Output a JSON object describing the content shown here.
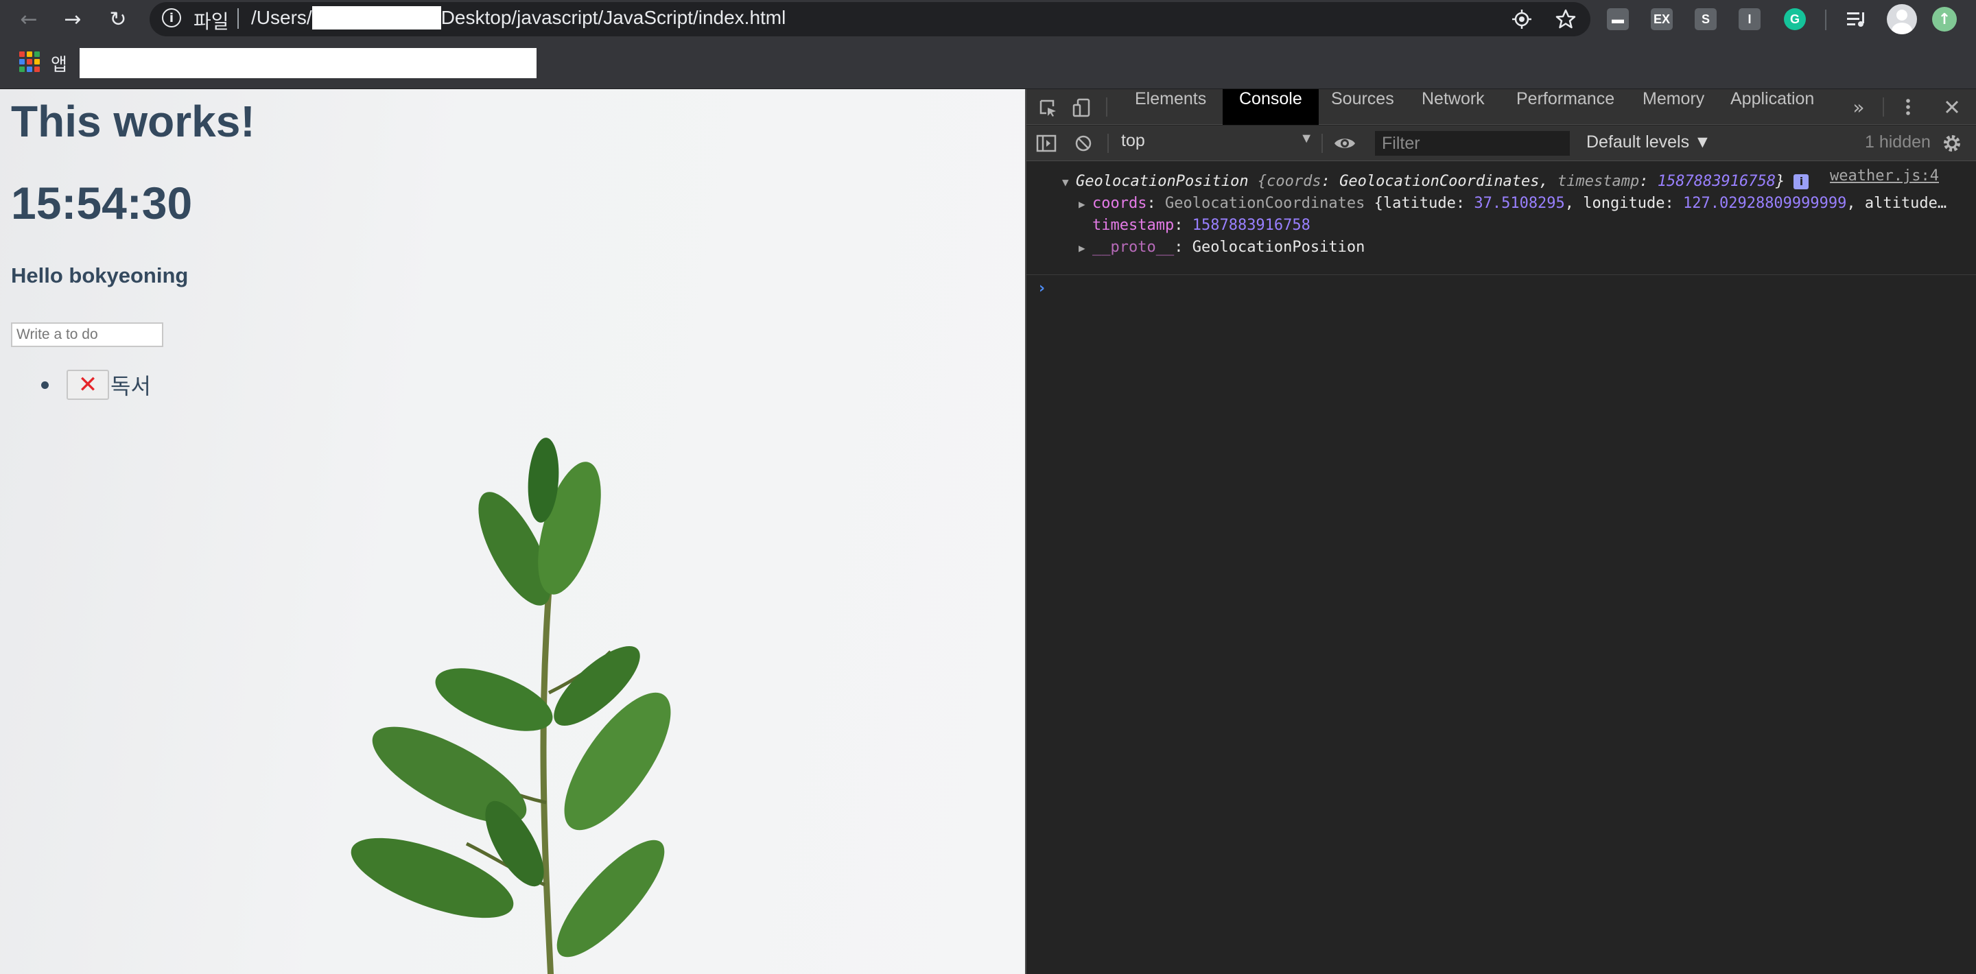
{
  "browser": {
    "nav": {
      "back_icon": "←",
      "forward_icon": "→",
      "reload_icon": "↻"
    },
    "omnibox": {
      "info_icon": "i",
      "scheme_label": "파일",
      "url_prefix": "/Users/",
      "url_suffix": "Desktop/javascript/JavaScript/index.html"
    },
    "extensions": [
      {
        "name": "extension-1-icon",
        "label": "▬",
        "color": "#5f6368"
      },
      {
        "name": "extension-ex-icon",
        "label": "EX",
        "color": "#5f6368"
      },
      {
        "name": "extension-s-icon",
        "label": "S",
        "color": "#5f6368"
      },
      {
        "name": "extension-i-icon",
        "label": "I",
        "color": "#5f6368"
      },
      {
        "name": "grammarly-icon",
        "label": "G",
        "color": "#15c39a"
      }
    ],
    "update_icon": "↑"
  },
  "bookmarks": {
    "apps_label": "앱"
  },
  "page": {
    "title": "This works!",
    "clock": "15:54:30",
    "greeting": "Hello bokyeoning",
    "todo_placeholder": "Write a to do",
    "todos": [
      {
        "delete_label": "✕",
        "text": "독서"
      }
    ]
  },
  "devtools": {
    "tabs": [
      "Elements",
      "Console",
      "Sources",
      "Network",
      "Performance",
      "Memory",
      "Application"
    ],
    "active_tab": "Console",
    "more_tabs": "»",
    "context": "top",
    "filter_placeholder": "Filter",
    "levels": "Default levels ▼",
    "hidden": "1 hidden",
    "console": {
      "source": "weather.js:4",
      "summary_type": "GeolocationPosition",
      "summary_open": " {",
      "summary_coords_key": "coords",
      "summary_coords_val": ": GeolocationCoordinates, ",
      "summary_ts_key": "timestamp",
      "summary_ts_sep": ": ",
      "summary_ts_val": "1587883916758",
      "summary_close": "}",
      "info_badge": "i",
      "coords_key": "coords",
      "coords_sep": ": ",
      "coords_type": "GeolocationCoordinates",
      "coords_lat_prefix": " {latitude: ",
      "coords_lat": "37.5108295",
      "coords_lng_prefix": ", longitude: ",
      "coords_lng": "127.02928809999999",
      "coords_tail": ", altitude…",
      "timestamp_key": "timestamp",
      "timestamp_sep": ": ",
      "timestamp_val": "1587883916758",
      "proto_key": "__proto__",
      "proto_sep": ": ",
      "proto_val": "GeolocationPosition",
      "prompt": "›"
    }
  }
}
